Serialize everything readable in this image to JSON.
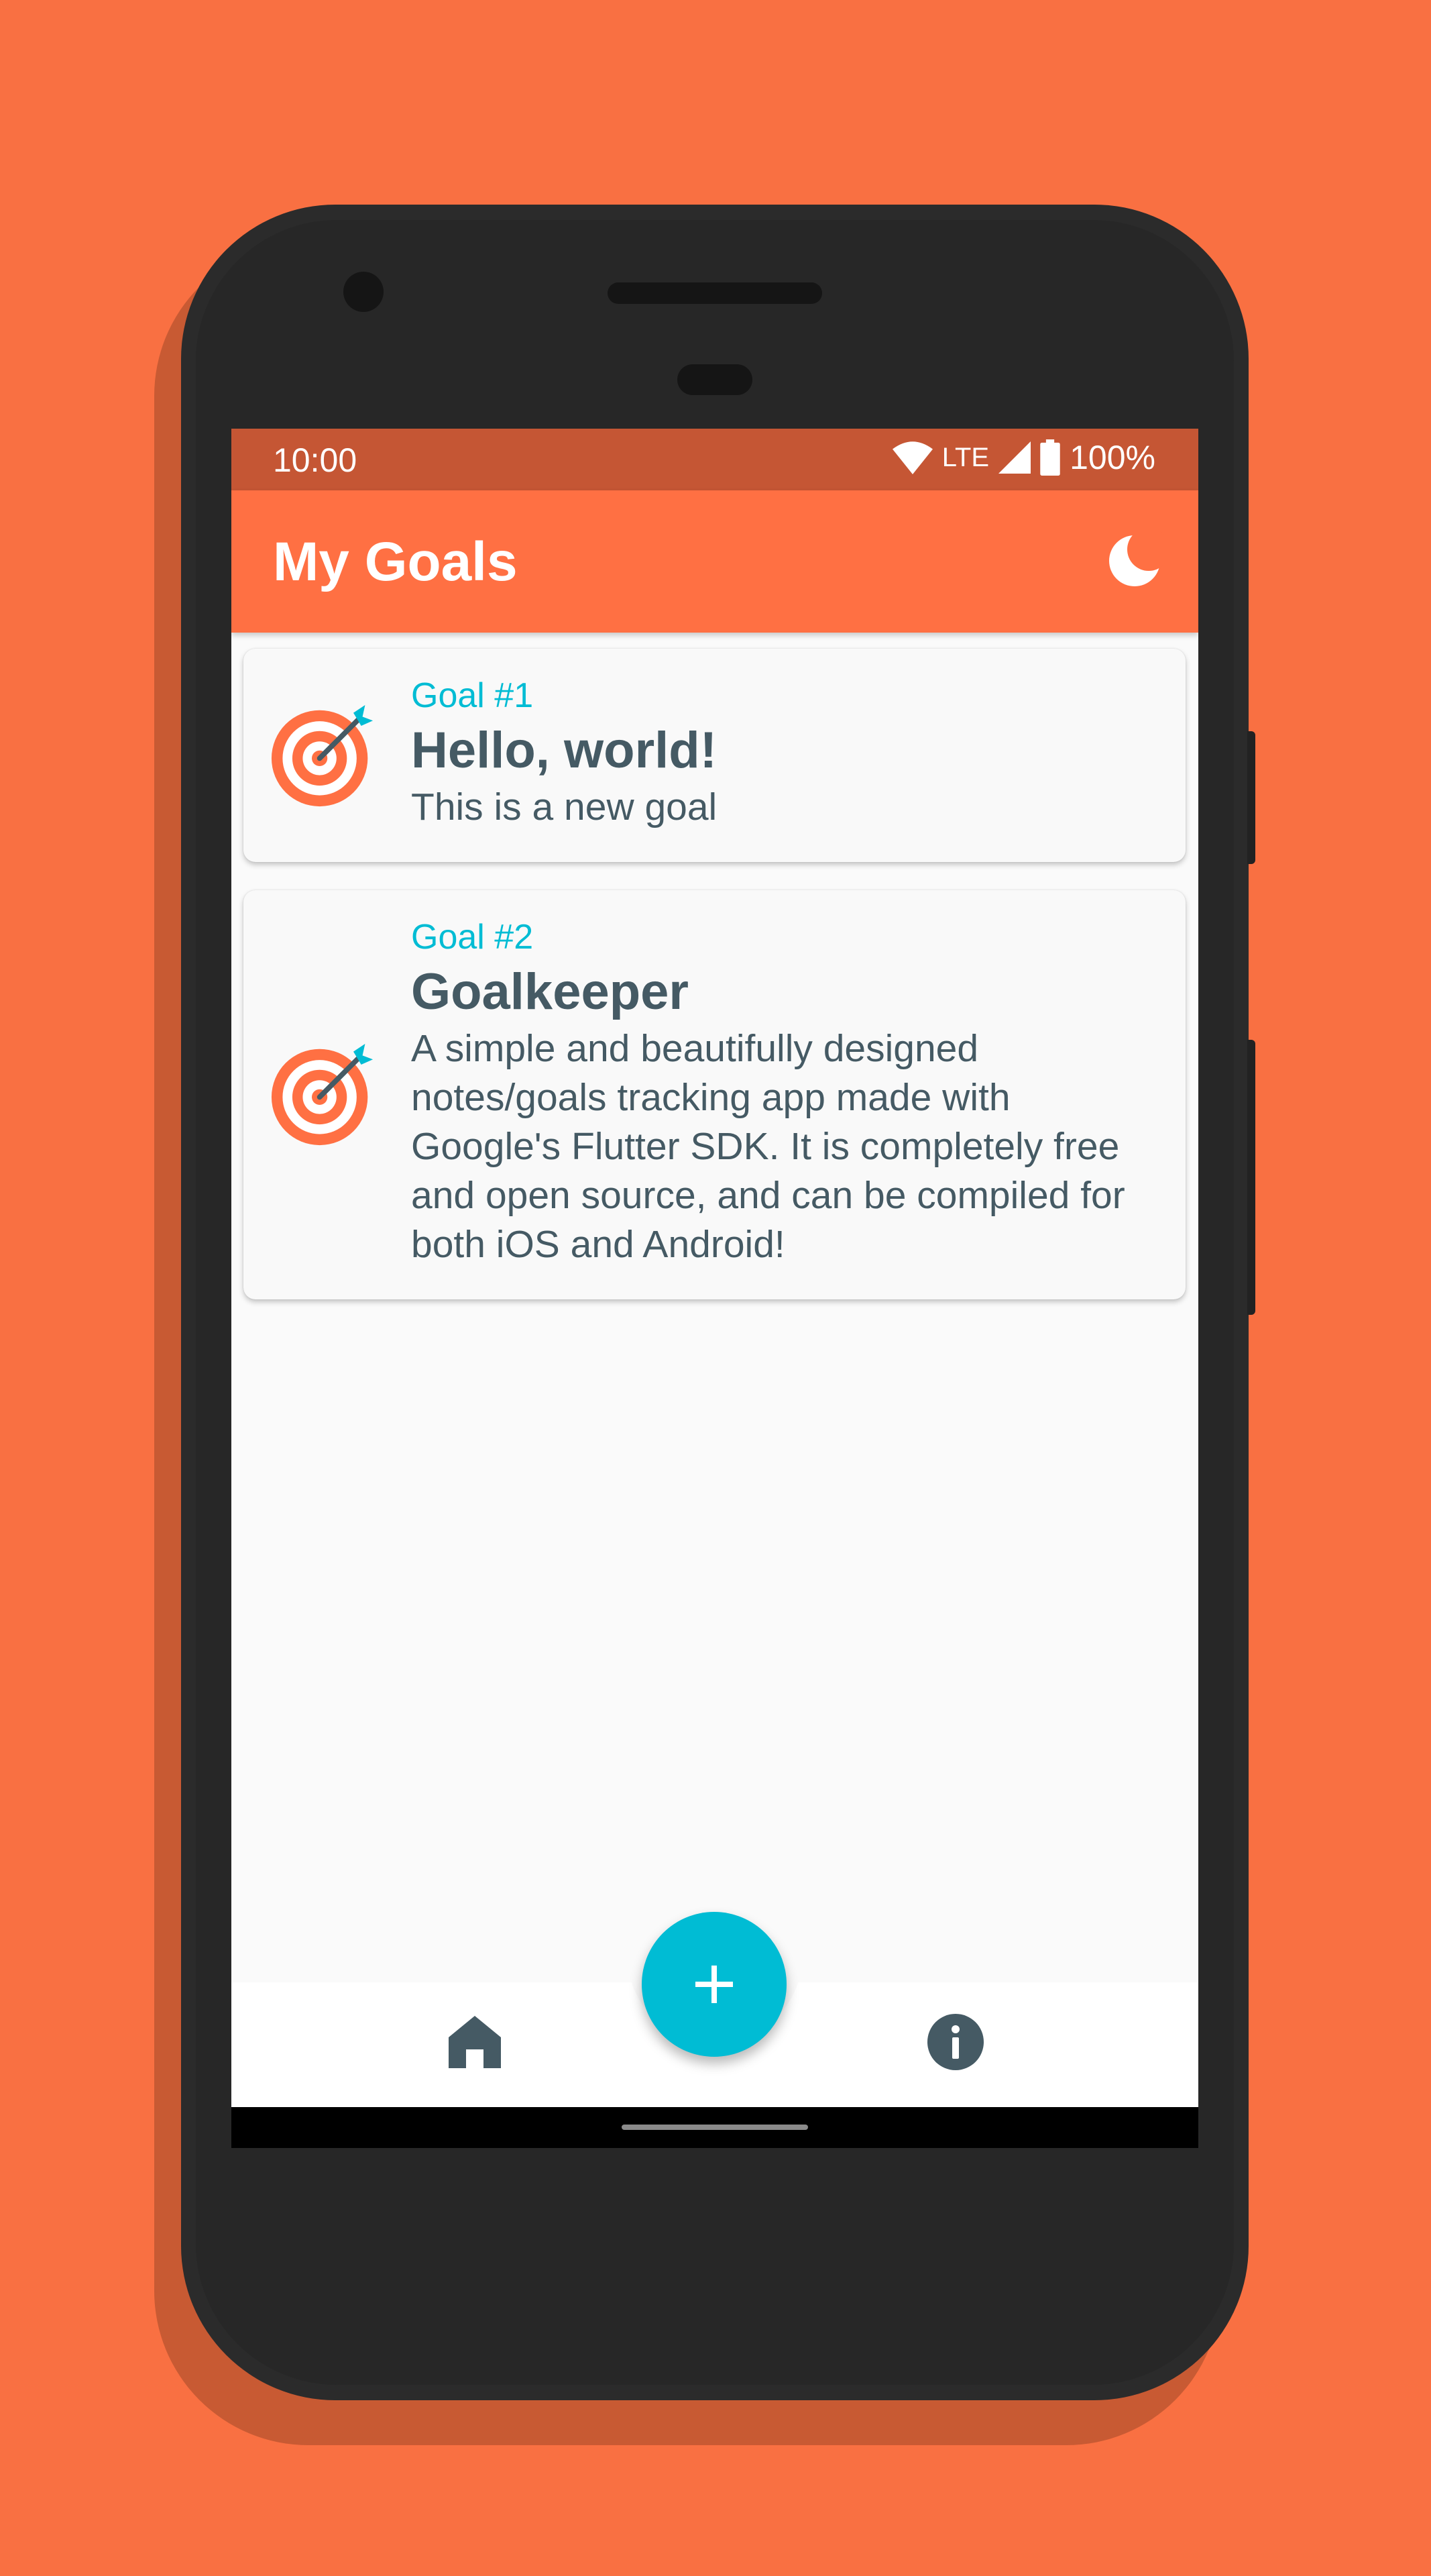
{
  "status_bar": {
    "time": "10:00",
    "network": "LTE",
    "battery": "100%"
  },
  "app_bar": {
    "title": "My Goals",
    "theme_toggle_icon": "moon-icon"
  },
  "goals": [
    {
      "number": "Goal #1",
      "title": "Hello, world!",
      "description": "This is a new goal",
      "icon": "target-icon"
    },
    {
      "number": "Goal #2",
      "title": "Goalkeeper",
      "description": "A simple and beautifully designed notes/goals tracking app made with Google's Flutter SDK. It is completely free and open source, and can be compiled for both iOS and Android!",
      "icon": "target-icon"
    }
  ],
  "fab": {
    "icon": "plus-icon"
  },
  "bottom_nav": {
    "items": [
      {
        "icon": "home-icon"
      },
      {
        "icon": "info-icon"
      }
    ]
  },
  "colors": {
    "background": "#F97042",
    "app_bar": "#FF7043",
    "status_bar": "#C55634",
    "accent": "#00BCD4",
    "text": "#455A64"
  }
}
